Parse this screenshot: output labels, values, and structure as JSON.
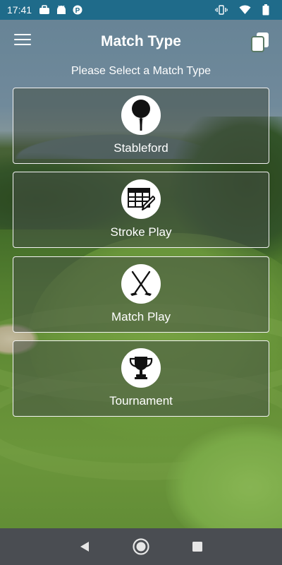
{
  "status_bar": {
    "time": "17:41",
    "left_icons": [
      "briefcase-icon",
      "android-icon",
      "p-app-icon"
    ],
    "right_icons": [
      "vibrate-icon",
      "wifi-icon",
      "battery-icon"
    ],
    "color": "#1f6b8a"
  },
  "header": {
    "title": "Match Type",
    "menu_icon": "hamburger-menu-icon",
    "action_icon": "copy-icon"
  },
  "subtitle": "Please Select a Match Type",
  "options": [
    {
      "label": "Stableford",
      "icon": "golf-ball-tee-icon"
    },
    {
      "label": "Stroke Play",
      "icon": "scorecard-pencil-icon"
    },
    {
      "label": "Match Play",
      "icon": "crossed-golf-clubs-icon"
    },
    {
      "label": "Tournament",
      "icon": "trophy-icon"
    }
  ],
  "nav_bar": {
    "buttons": [
      "back-icon",
      "home-icon",
      "recents-icon"
    ],
    "color": "#4a4d52"
  }
}
